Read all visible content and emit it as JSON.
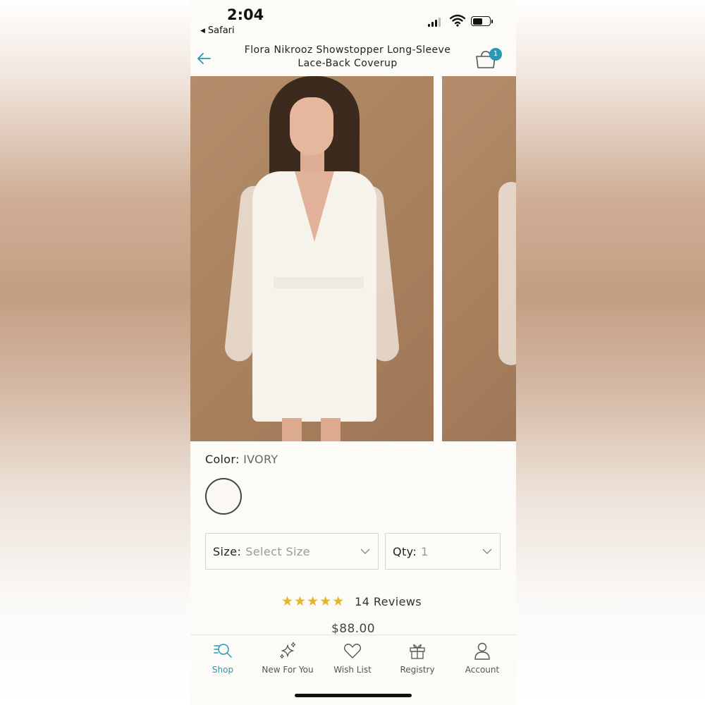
{
  "status_bar": {
    "time": "2:04",
    "back_app_label": "Safari",
    "battery_level": 0.6
  },
  "header": {
    "title_line1": "Flora Nikrooz Showstopper Long-Sleeve",
    "title_line2": "Lace-Back Coverup",
    "cart_count": "1"
  },
  "product": {
    "color_label": "Color:",
    "color_value": "IVORY",
    "size_label": "Size:",
    "size_value": "Select Size",
    "qty_label": "Qty:",
    "qty_value": "1",
    "rating_stars": "★★★★★",
    "rating_value": 5,
    "reviews_text": "14 Reviews",
    "price": "$88.00"
  },
  "tab_bar": {
    "items": [
      {
        "label": "Shop",
        "icon": "shop-search-icon",
        "active": true
      },
      {
        "label": "New For You",
        "icon": "sparkles-icon",
        "active": false
      },
      {
        "label": "Wish List",
        "icon": "heart-icon",
        "active": false
      },
      {
        "label": "Registry",
        "icon": "gift-icon",
        "active": false
      },
      {
        "label": "Account",
        "icon": "person-icon",
        "active": false
      }
    ]
  },
  "colors": {
    "accent": "#2a98b4",
    "star": "#e6b428"
  }
}
